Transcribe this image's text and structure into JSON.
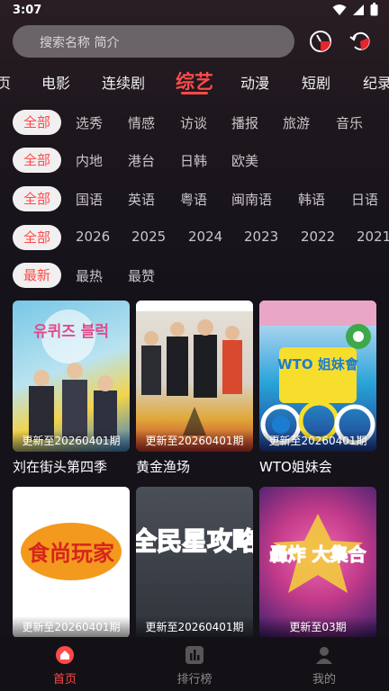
{
  "status": {
    "time": "3:07"
  },
  "search": {
    "placeholder": "搜索名称 简介"
  },
  "tabs": [
    {
      "label": "页"
    },
    {
      "label": "电影"
    },
    {
      "label": "连续剧"
    },
    {
      "label": "综艺"
    },
    {
      "label": "动漫"
    },
    {
      "label": "短剧"
    },
    {
      "label": "纪录"
    }
  ],
  "filters": {
    "type": {
      "selected": "全部",
      "options": [
        "选秀",
        "情感",
        "访谈",
        "播报",
        "旅游",
        "音乐"
      ]
    },
    "region": {
      "selected": "全部",
      "options": [
        "内地",
        "港台",
        "日韩",
        "欧美"
      ]
    },
    "language": {
      "selected": "全部",
      "options": [
        "国语",
        "英语",
        "粤语",
        "闽南语",
        "韩语",
        "日语"
      ]
    },
    "year": {
      "selected": "全部",
      "options": [
        "2026",
        "2025",
        "2024",
        "2023",
        "2022",
        "2021"
      ]
    },
    "sort": {
      "selected": "最新",
      "options": [
        "最热",
        "最赞"
      ]
    }
  },
  "cards": [
    {
      "title": "刘在街头第四季",
      "episode": "更新至20260401期"
    },
    {
      "title": "黄金渔场",
      "episode": "更新至20260401期"
    },
    {
      "title": "WTO姐妹会",
      "episode": "更新至20260401期"
    },
    {
      "title": "",
      "episode": "更新至20260401期"
    },
    {
      "title": "",
      "episode": "更新至20260401期"
    },
    {
      "title": "",
      "episode": "更新至03期"
    }
  ],
  "posters": [
    {
      "text": "유퀴즈 블럭"
    },
    {
      "text": ""
    },
    {
      "text": "WTO 姐妹會"
    },
    {
      "text": "食尚玩家"
    },
    {
      "text": "全民星攻略"
    },
    {
      "text": "轟炸 大集合"
    }
  ],
  "bottom_nav": [
    {
      "label": "首页"
    },
    {
      "label": "排行榜"
    },
    {
      "label": "我的"
    }
  ],
  "colors": {
    "accent": "#ff4a4a",
    "background": "#15121a",
    "chip": "#f1eff0"
  }
}
